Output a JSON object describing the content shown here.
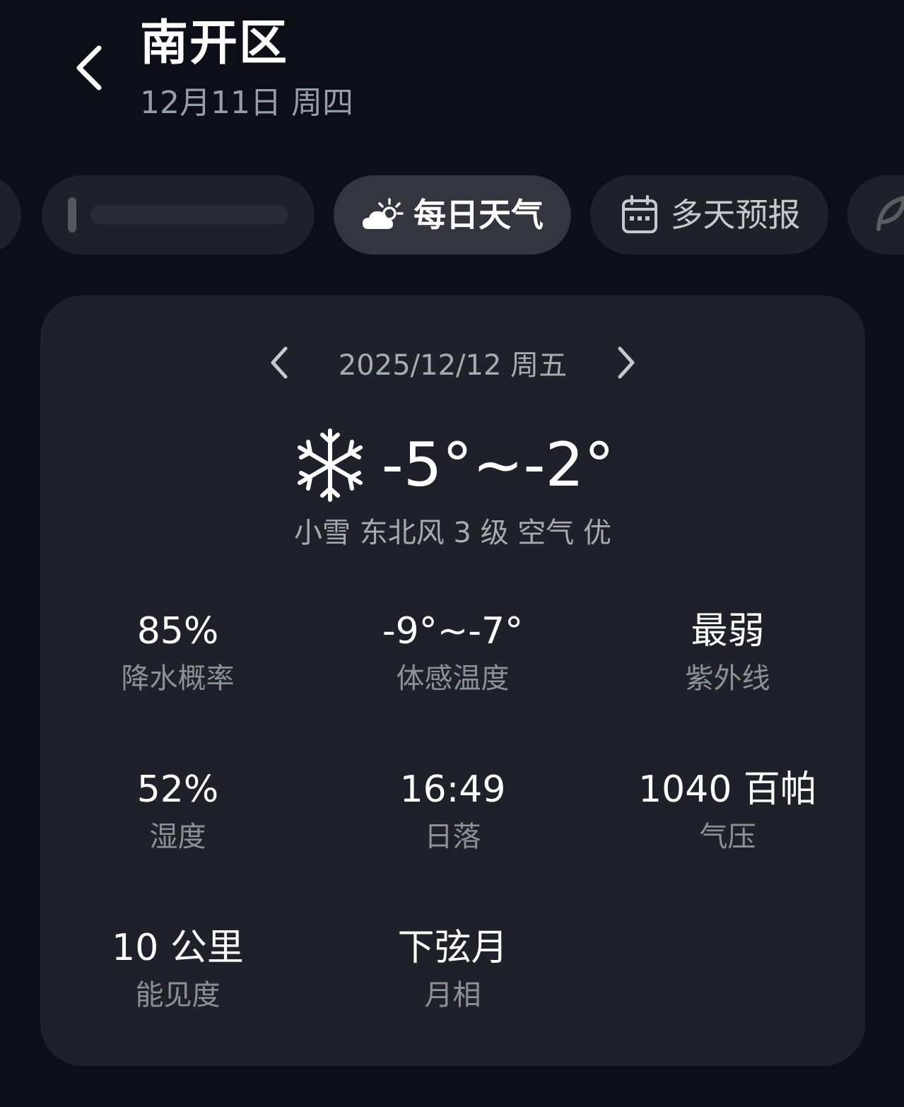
{
  "header": {
    "back_icon": "chevron-left-icon",
    "title": "南开区",
    "subtitle": "12月11日 周四"
  },
  "tabs": [
    {
      "label": "",
      "icon": "hidden-tab"
    },
    {
      "label": "",
      "icon": "blurred-tab"
    },
    {
      "label": "每日天气",
      "icon": "partly-cloudy-icon",
      "active": true
    },
    {
      "label": "多天预报",
      "icon": "calendar-icon",
      "active": false
    },
    {
      "label": "",
      "icon": "leaf-icon"
    }
  ],
  "card": {
    "date": "2025/12/12 周五",
    "prev_icon": "chevron-left-icon",
    "next_icon": "chevron-right-icon",
    "weather_icon": "snowflake-icon",
    "temperature": "-5°~-2°",
    "description": "小雪 东北风 3 级 空气 优",
    "details": [
      {
        "value": "85%",
        "label": "降水概率"
      },
      {
        "value": "-9°~-7°",
        "label": "体感温度"
      },
      {
        "value": "最弱",
        "label": "紫外线"
      },
      {
        "value": "52%",
        "label": "湿度"
      },
      {
        "value": "16:49",
        "label": "日落"
      },
      {
        "value": "1040 百帕",
        "label": "气压"
      },
      {
        "value": "10 公里",
        "label": "能见度"
      },
      {
        "value": "下弦月",
        "label": "月相"
      }
    ]
  },
  "colors": {
    "background": "#0d0e17",
    "card": "#1f2029",
    "active_tab": "#34353e",
    "secondary_text": "#8e9098"
  }
}
